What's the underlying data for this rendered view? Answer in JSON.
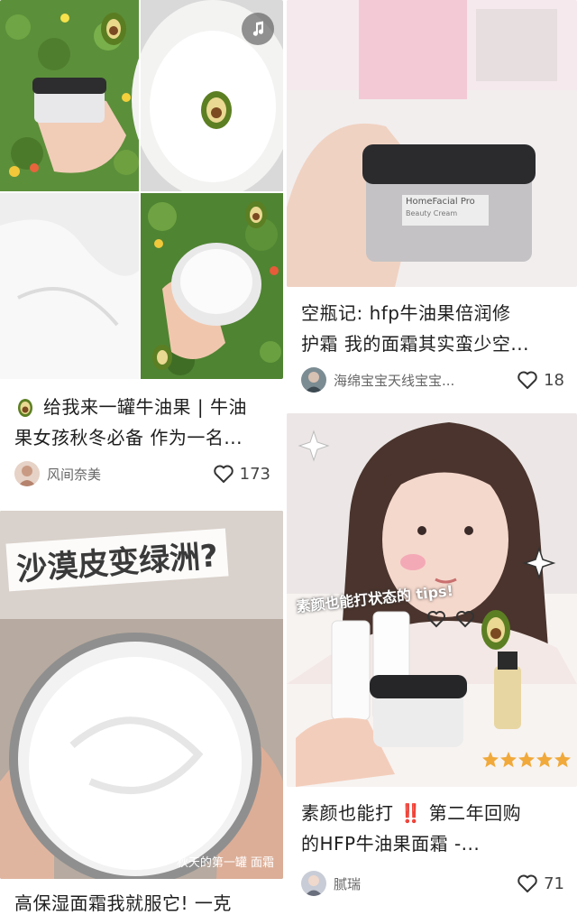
{
  "cards": [
    {
      "title_line1": "给我来一罐牛油果 | 牛油",
      "title_line2": "果女孩秋冬必备 作为一名...",
      "author": "风间奈美",
      "likes": "173",
      "title_emoji": "avocado-emoji"
    },
    {
      "overlay_text": "沙漠皮变绿洲?",
      "caption_overlay": "秋天的第一罐 面霜",
      "title_line1": "高保湿面霜我就服它! 一克"
    },
    {
      "title_line1": "空瓶记: hfp牛油果倍润修",
      "title_line2": "护霜 我的面霜其实蛮少空...",
      "author": "海绵宝宝天线宝宝...",
      "likes": "18",
      "jar_label": "HomeFacial Pro",
      "jar_sublabel": "Beauty Cream"
    },
    {
      "overlay_text": "素颜也能打状态的 tips!",
      "title_line1": "素颜也能打 ‼️ 第二年回购",
      "title_line2": "的HFP牛油果面霜 -...",
      "author": "腻瑞",
      "likes": "71",
      "stars": 5
    }
  ],
  "icons": {
    "music": "music-note-icon",
    "like": "heart-outline-icon"
  },
  "colors": {
    "title": "#1e1e1e",
    "meta": "#666666",
    "avocado": "#7a9a2a",
    "star": "#f0a93a"
  }
}
